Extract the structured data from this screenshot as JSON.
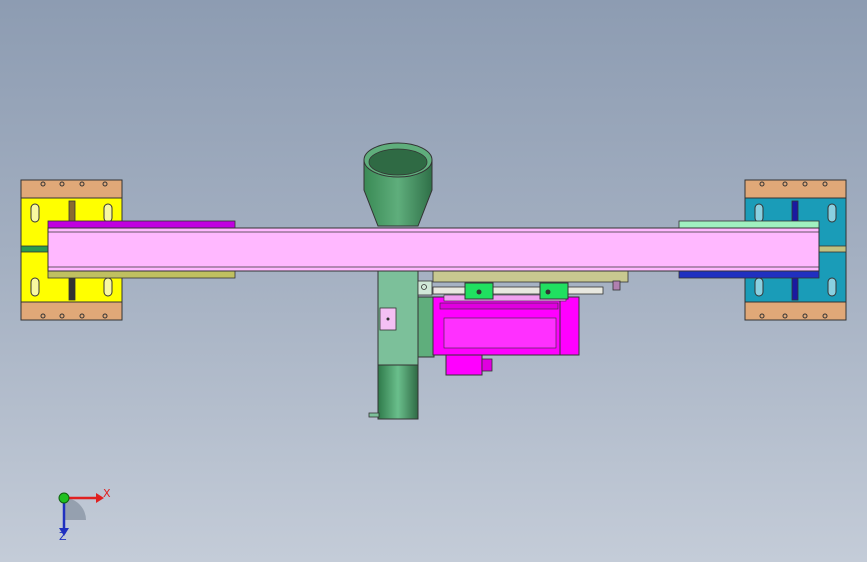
{
  "viewport": {
    "background_top": "#8d9cb2",
    "background_bottom": "#c4ccd8"
  },
  "triad": {
    "x_label": "X",
    "z_label": "Z",
    "x_color": "#e02020",
    "y_color": "#20c020",
    "z_color": "#2030c0"
  },
  "model_colors": {
    "left_plate": "#ffff00",
    "right_plate": "#1a9cb8",
    "mount_blocks": "#e0a878",
    "conveyor_belt": "#ffb8ff",
    "hopper": "#4f9a6a",
    "motor": "#ff00ff",
    "brackets": "#20e060",
    "rail": "#c0c090"
  }
}
